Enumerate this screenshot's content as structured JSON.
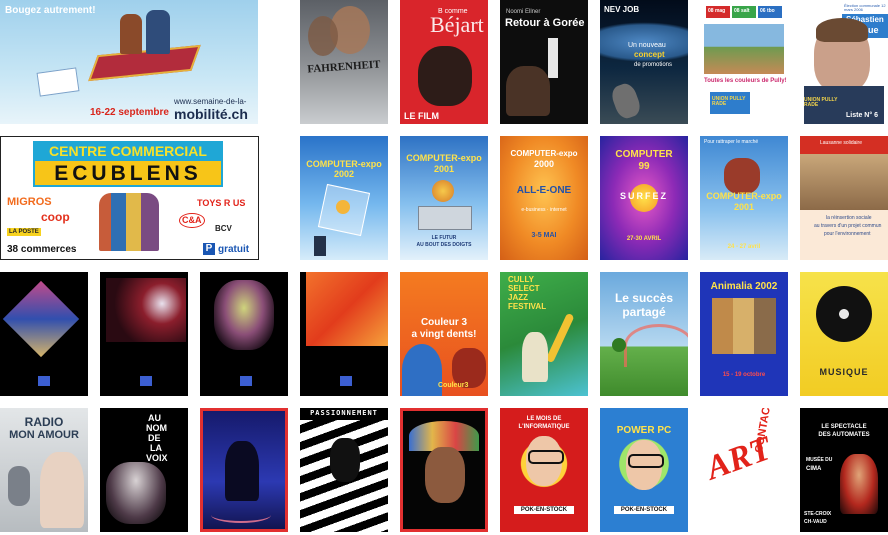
{
  "mobilite": {
    "headline": "Bougez autrement!",
    "dates": "16-22 septembre",
    "url_prefix": "www.semaine-de-la-",
    "url_main": "mobilité.ch"
  },
  "cc": {
    "line1": "CENTRE COMMERCIAL",
    "line2": "ECUBLENS",
    "migros": "MIGROS",
    "coop": "coop",
    "toysrus": "TOYS R US",
    "laposte": "LA POSTE",
    "ca": "C&A",
    "bcv": "BCV",
    "count": "38 commerces",
    "parking": "gratuit"
  },
  "r1": {
    "fahrenheit": "FAHRENHEIT",
    "bejart_b": "B comme",
    "bejart_name": "Béjart",
    "bejart_film": "LE FILM",
    "goree_sub": "Noomi Ellner",
    "goree_title": "Retour à Gorée",
    "job_title": "NEV JOB",
    "job_tag1": "Un nouveau",
    "job_tag2": "concept",
    "job_tag3": "de promotions",
    "pully_tabs": [
      "08 mag",
      "08 salt",
      "06 tbo"
    ],
    "pully_slogan": "Toutes les couleurs de Pully!",
    "pully_union": "UNION PULLY RADE",
    "fague_head": "Élection communale 12 mars 2006",
    "fague_name1": "Sébastien",
    "fague_name2": "Fague",
    "fague_union": "UNION PULLY RADE",
    "fague_list": "Liste N° 6"
  },
  "r2": {
    "c2002_title": "COMPUTER-expo",
    "c2002_year": "2002",
    "c2001_title": "COMPUTER-expo",
    "c2001_year": "2001",
    "c2001_tag1": "LE FUTUR",
    "c2001_tag2": "AU BOUT DES DOIGTS",
    "c2000_title": "COMPUTER-expo",
    "c2000_year": "2000",
    "c2000_logo": "ALL-E-ONE",
    "c2000_badge": "e-business · internet",
    "c2000_dates": "3-5 MAI",
    "c99_title": "COMPUTER",
    "c99_year": "99",
    "c99_surf": "SURFEZ",
    "c99_dates": "27-30 AVRIL",
    "c2001b_head": "Pour rattraper le marché",
    "c2001b_title": "COMPUTER-expo",
    "c2001b_year": "2001",
    "c2001b_dates": "24 - 27 avril",
    "soli_head": "Lausanne solidaire",
    "soli_text1": "la réinsertion sociale",
    "soli_text2": "au travers d'un projet commun",
    "soli_text3": "pour l'environnement"
  },
  "r3": {
    "couleur1": "Couleur 3",
    "couleur2": "a vingt dents!",
    "couleur_logo": "Couleur3",
    "jazz1": "CULLY",
    "jazz2": "SELECT",
    "jazz3": "JAZZ",
    "jazz4": "FESTIVAL",
    "succes1": "Le succès",
    "succes2": "partagé",
    "animalia": "Animalia 2002",
    "animalia_dates": "15 - 19 octobre",
    "musique": "MUSIQUE"
  },
  "r4": {
    "radio1": "RADIO",
    "radio2": "MON AMOUR",
    "voix": [
      "AU",
      "NOM",
      "DE",
      "LA",
      "VOIX"
    ],
    "passion": "PASSIONNEMENT",
    "power1": "LE MOIS DE",
    "power2": "L'INFORMATIQUE",
    "pok": "POK-EN-STOCK",
    "power_pc": "POWER PC",
    "art": "ART",
    "contact": "CONTACT",
    "automates1": "LE SPECTACLE",
    "automates2": "DES AUTOMATES",
    "musee1": "MUSÉE DU",
    "musee2": "CIMA",
    "stecroix1": "STE-CROIX",
    "stecroix2": "CH-VAUD"
  },
  "colors": {
    "accent_red": "#e41d24",
    "deep_blue": "#1f35b8",
    "sky_blue": "#4a90d8",
    "ecublens_yellow": "#f7c518"
  }
}
